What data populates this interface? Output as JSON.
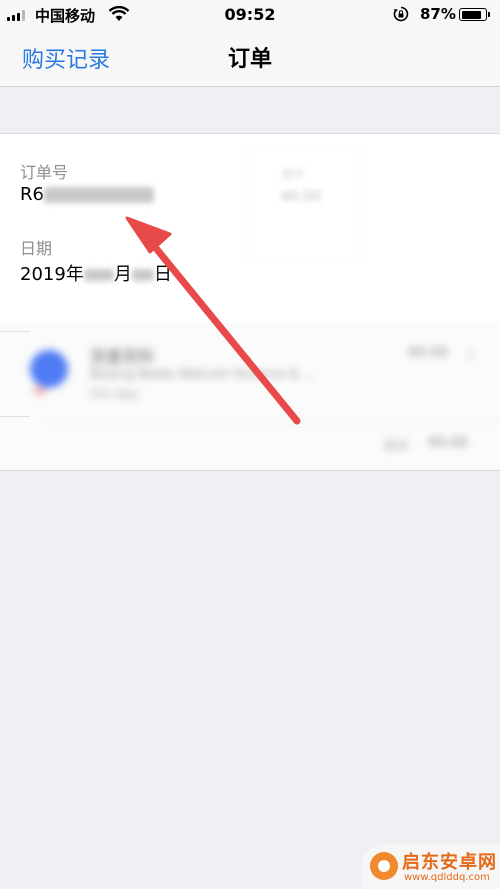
{
  "status_bar": {
    "carrier": "中国移动",
    "time": "09:52",
    "battery_percent": "87%",
    "battery_level": 0.87
  },
  "nav": {
    "back_label": "购买记录",
    "title": "订单"
  },
  "order": {
    "order_number_label": "订单号",
    "order_number_visible": "R6",
    "date_label": "日期",
    "date_prefix": "2019",
    "date_year_char": "年",
    "date_month_char": "月",
    "date_day_char": "日"
  },
  "watermark": {
    "brand": "启东安卓网",
    "url": "www.qdlddq.com"
  },
  "colors": {
    "accent": "#2a7ae2",
    "annotation_arrow": "#e84a4a",
    "watermark": "#e46a1a"
  }
}
